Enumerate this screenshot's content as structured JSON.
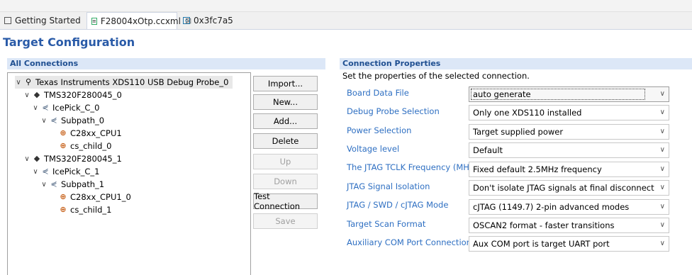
{
  "tabs": [
    {
      "label": "Getting Started",
      "icon": "page-icon"
    },
    {
      "label": "F28004xOtp.ccxml",
      "icon": "ccxml-file-icon",
      "close": "⊠"
    },
    {
      "label": "0x3fc7a5",
      "icon": "memory-icon"
    }
  ],
  "page_title": "Target Configuration",
  "connections": {
    "header": "All Connections",
    "tree": [
      {
        "label": "Texas Instruments XDS110 USB Debug Probe_0",
        "level": 0,
        "icon": "probe-icon",
        "selected": true
      },
      {
        "label": "TMS320F280045_0",
        "level": 1,
        "icon": "chip-icon"
      },
      {
        "label": "IcePick_C_0",
        "level": 2,
        "icon": "icepick-icon"
      },
      {
        "label": "Subpath_0",
        "level": 3,
        "icon": "subpath-icon"
      },
      {
        "label": "C28xx_CPU1",
        "level": 4,
        "icon": "cpu-icon"
      },
      {
        "label": "cs_child_0",
        "level": 4,
        "icon": "cpu-icon"
      },
      {
        "label": "TMS320F280045_1",
        "level": 1,
        "icon": "chip-icon"
      },
      {
        "label": "IcePick_C_1",
        "level": 2,
        "icon": "icepick-icon"
      },
      {
        "label": "Subpath_1",
        "level": 3,
        "icon": "subpath-icon"
      },
      {
        "label": "C28xx_CPU1_0",
        "level": 4,
        "icon": "cpu-icon"
      },
      {
        "label": "cs_child_1",
        "level": 4,
        "icon": "cpu-icon"
      }
    ]
  },
  "buttons": {
    "import": "Import...",
    "new": "New...",
    "add": "Add...",
    "delete": "Delete",
    "up": "Up",
    "down": "Down",
    "test": "Test Connection",
    "save": "Save"
  },
  "properties": {
    "header": "Connection Properties",
    "description": "Set the properties of the selected connection.",
    "rows": [
      {
        "label": "Board Data File",
        "value": "auto generate"
      },
      {
        "label": "Debug Probe Selection",
        "value": "Only one XDS110 installed"
      },
      {
        "label": "Power Selection",
        "value": "Target supplied power"
      },
      {
        "label": "Voltage level",
        "value": "Default"
      },
      {
        "label": "The JTAG TCLK Frequency (MHz)",
        "value": "Fixed default 2.5MHz frequency"
      },
      {
        "label": "JTAG Signal Isolation",
        "value": "Don't isolate JTAG signals at final disconnect"
      },
      {
        "label": "JTAG / SWD / cJTAG Mode",
        "value": "cJTAG (1149.7) 2-pin advanced modes"
      },
      {
        "label": "Target Scan Format",
        "value": "OSCAN2 format - faster transitions"
      },
      {
        "label": "Auxiliary COM Port Connection",
        "value": "Aux COM port is target UART port"
      }
    ]
  },
  "colors": {
    "title": "#2a5ba8",
    "section_bg": "#dce7f7",
    "label": "#2e6fc2",
    "cpu_icon": "#c8641e"
  }
}
